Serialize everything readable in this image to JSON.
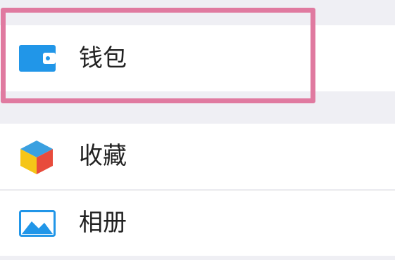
{
  "menu": {
    "wallet": {
      "label": "钱包",
      "icon": "wallet-icon",
      "color": "#2196e8"
    },
    "favorites": {
      "label": "收藏",
      "icon": "cube-icon",
      "colors": [
        "#3aa0e0",
        "#f5c518",
        "#e84b3c"
      ]
    },
    "album": {
      "label": "相册",
      "icon": "photo-icon",
      "color": "#2196e8"
    }
  },
  "highlight_color": "#e07aa0"
}
